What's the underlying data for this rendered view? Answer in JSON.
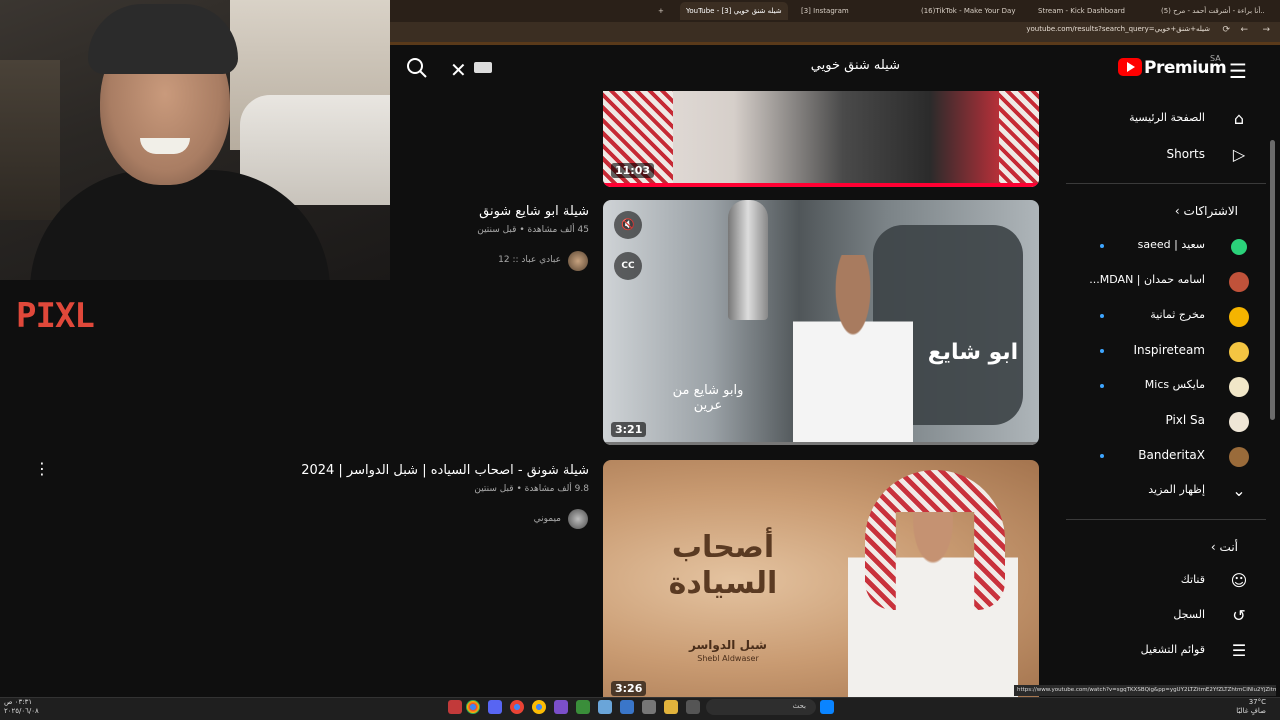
{
  "browser": {
    "tabs": [
      {
        "label": "YouTube - شيله شنق خويي [3]",
        "active": true
      },
      {
        "label": "[3] Instagram",
        "active": false
      },
      {
        "label": "(16)TikTok - Make Your Day",
        "active": false
      },
      {
        "label": "Stream - Kick Dashboard",
        "active": false
      },
      {
        "label": "(5) أنا براءة - أشرقت أحمد - مرح...",
        "active": false
      }
    ],
    "url": "youtube.com/results?search_query=شيله+شنق+خويي"
  },
  "overlay": {
    "brand": "PIXL"
  },
  "youtube": {
    "logo_text": "Premium",
    "region": "SA",
    "search_value": "شيله شنق خويي"
  },
  "results": [
    {
      "duration": "11:03"
    },
    {
      "title": "شيلة ابو شايع شونق",
      "meta": "45 ألف مشاهدة • قبل سنتين",
      "channel": "عبادي عباد :: 12",
      "duration": "3:21",
      "caption": "وابو شايع من عرين",
      "thumb_text": "ابو شايع",
      "cc_label": "CC"
    },
    {
      "title": "شيلة شونق - اصحاب السياده | شبل الدواسر | 2024",
      "meta": "9.8 ألف مشاهدة • قبل سنتين",
      "channel": "ميموني",
      "duration": "3:26",
      "thumb_title": "أصحاب السيادة",
      "thumb_sub": "شبل الدواسر",
      "thumb_sub_en": "Shebl Aldwaser"
    }
  ],
  "sidebar": {
    "home": "الصفحة الرئيسية",
    "shorts": "Shorts",
    "subs_heading": "الاشتراكات",
    "subscriptions": [
      {
        "name": "سعيد | saeed",
        "color": "#2bd27a"
      },
      {
        "name": "اسامه حمدان | MDAN...",
        "color": "#c0523a"
      },
      {
        "name": "مخرج ثمانية",
        "color": "#f5b400"
      },
      {
        "name": "Inspireteam",
        "color": "#f4c542"
      },
      {
        "name": "مايكس Mics",
        "color": "#f1e7c8"
      },
      {
        "name": "Pixl Sa",
        "color": "#efe6d6"
      },
      {
        "name": "BanderitaX",
        "color": "#9a6b3a"
      }
    ],
    "show_more": "إظهار المزيد",
    "you_heading": "أنت",
    "you_items": [
      "قناتك",
      "السجل",
      "قوائم التشغيل"
    ]
  },
  "taskbar": {
    "search_placeholder": "بحث",
    "time": "٠٣:٣١ ص",
    "date": "٢٠٢٥/٠٦/٠٨",
    "weather_temp": "37°C",
    "weather_desc": "صافٍ غالبًا"
  },
  "status_url": "https://www.youtube.com/watch?v=sgqTKXSBQig&pp=ygUY2LTZitmE2YfZLTZhtmCINlu2YjZitmK"
}
